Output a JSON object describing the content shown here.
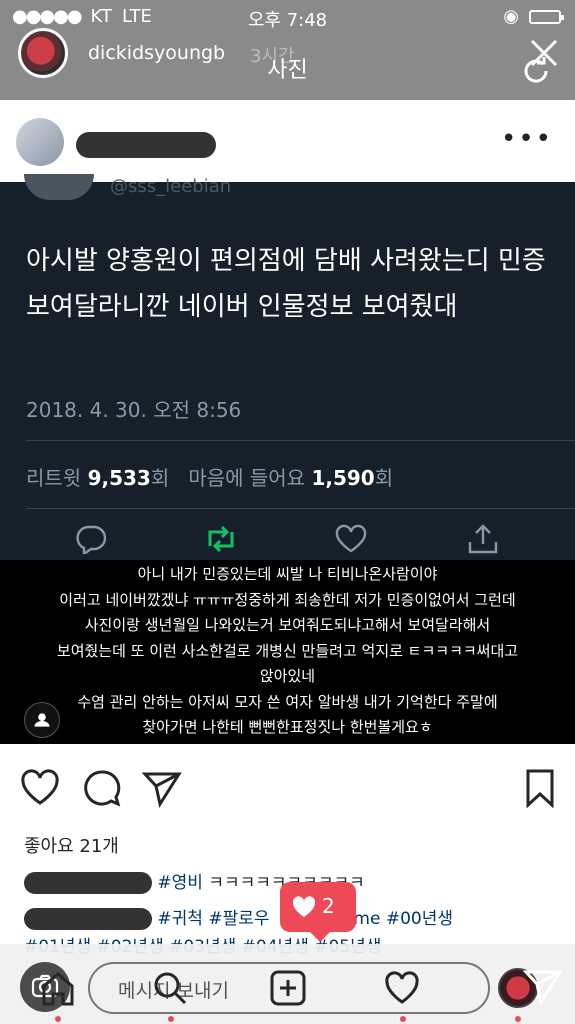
{
  "status_bar": {
    "signal": "●●●●●",
    "carrier": "KT",
    "network": "LTE",
    "time": "오후 7:48"
  },
  "story": {
    "username": "dickidsyoungb",
    "time_ago": "3시간",
    "title": "사진"
  },
  "tweet": {
    "handle": "@sss_leebian",
    "text": "아시발 양홍원이 편의점에 담배 사려왔는디 민증 보여달라니깐 네이버 인물정보 보여줬대",
    "date": "2018. 4. 30. 오전 8:56",
    "retweet_label": "리트윗",
    "retweet_count": "9,533",
    "count_unit": "회",
    "like_label": "마음에 들어요",
    "like_count": "1,590",
    "count_unit2": "회"
  },
  "overlay": {
    "lines": [
      "아니 내가 민증있는데 씨발 나 티비나온사람이야",
      "이러고 네이버깠겠냐 ㅠㅠㅠ정중하게 죄송한데 저가 민증이없어서 그런데",
      "사진이랑 생년월일 나와있는거 보여줘도되냐고해서 보여달라해서",
      "보여줬는데 또 이런 사소한걸로 개병신 만들려고 억지로 ㅌㅋㅋㅋㅋ써대고",
      "앉아있네",
      "수염 관리 안하는 아저씨 모자 쓴 여자 알바생 내가 기억한다 주말에",
      "찾아가면 나한테 뻔뻔한표정짓나 한번볼게요ㅎ"
    ]
  },
  "post": {
    "likes": "좋아요 21개",
    "comment1_text": "ㅋㅋㅋㅋㅋㅋㅋㅋㅋㅋ",
    "comment1_tag": "#영비",
    "comment2_tags": "#귀척 #팔로우",
    "comment2_tail": "wme #00년생",
    "comment3_tags": "#01년생 #02년생 #03년생 #04년생 #05년생"
  },
  "like_notice": {
    "count": "2"
  },
  "message_bar": {
    "placeholder": "메시지 보내기"
  },
  "colors": {
    "tweet_bg": "#15202b",
    "retweet_green": "#17bf63",
    "notice_red": "#ed4956",
    "hashtag": "#00376b"
  },
  "icons": [
    "close-icon",
    "refresh-icon",
    "more-icon",
    "reply-icon",
    "retweet-icon",
    "heart-icon",
    "share-icon",
    "comment-icon",
    "send-icon",
    "bookmark-icon",
    "camera-icon",
    "home-icon",
    "search-icon",
    "add-icon",
    "direct-icon",
    "user-icon"
  ]
}
